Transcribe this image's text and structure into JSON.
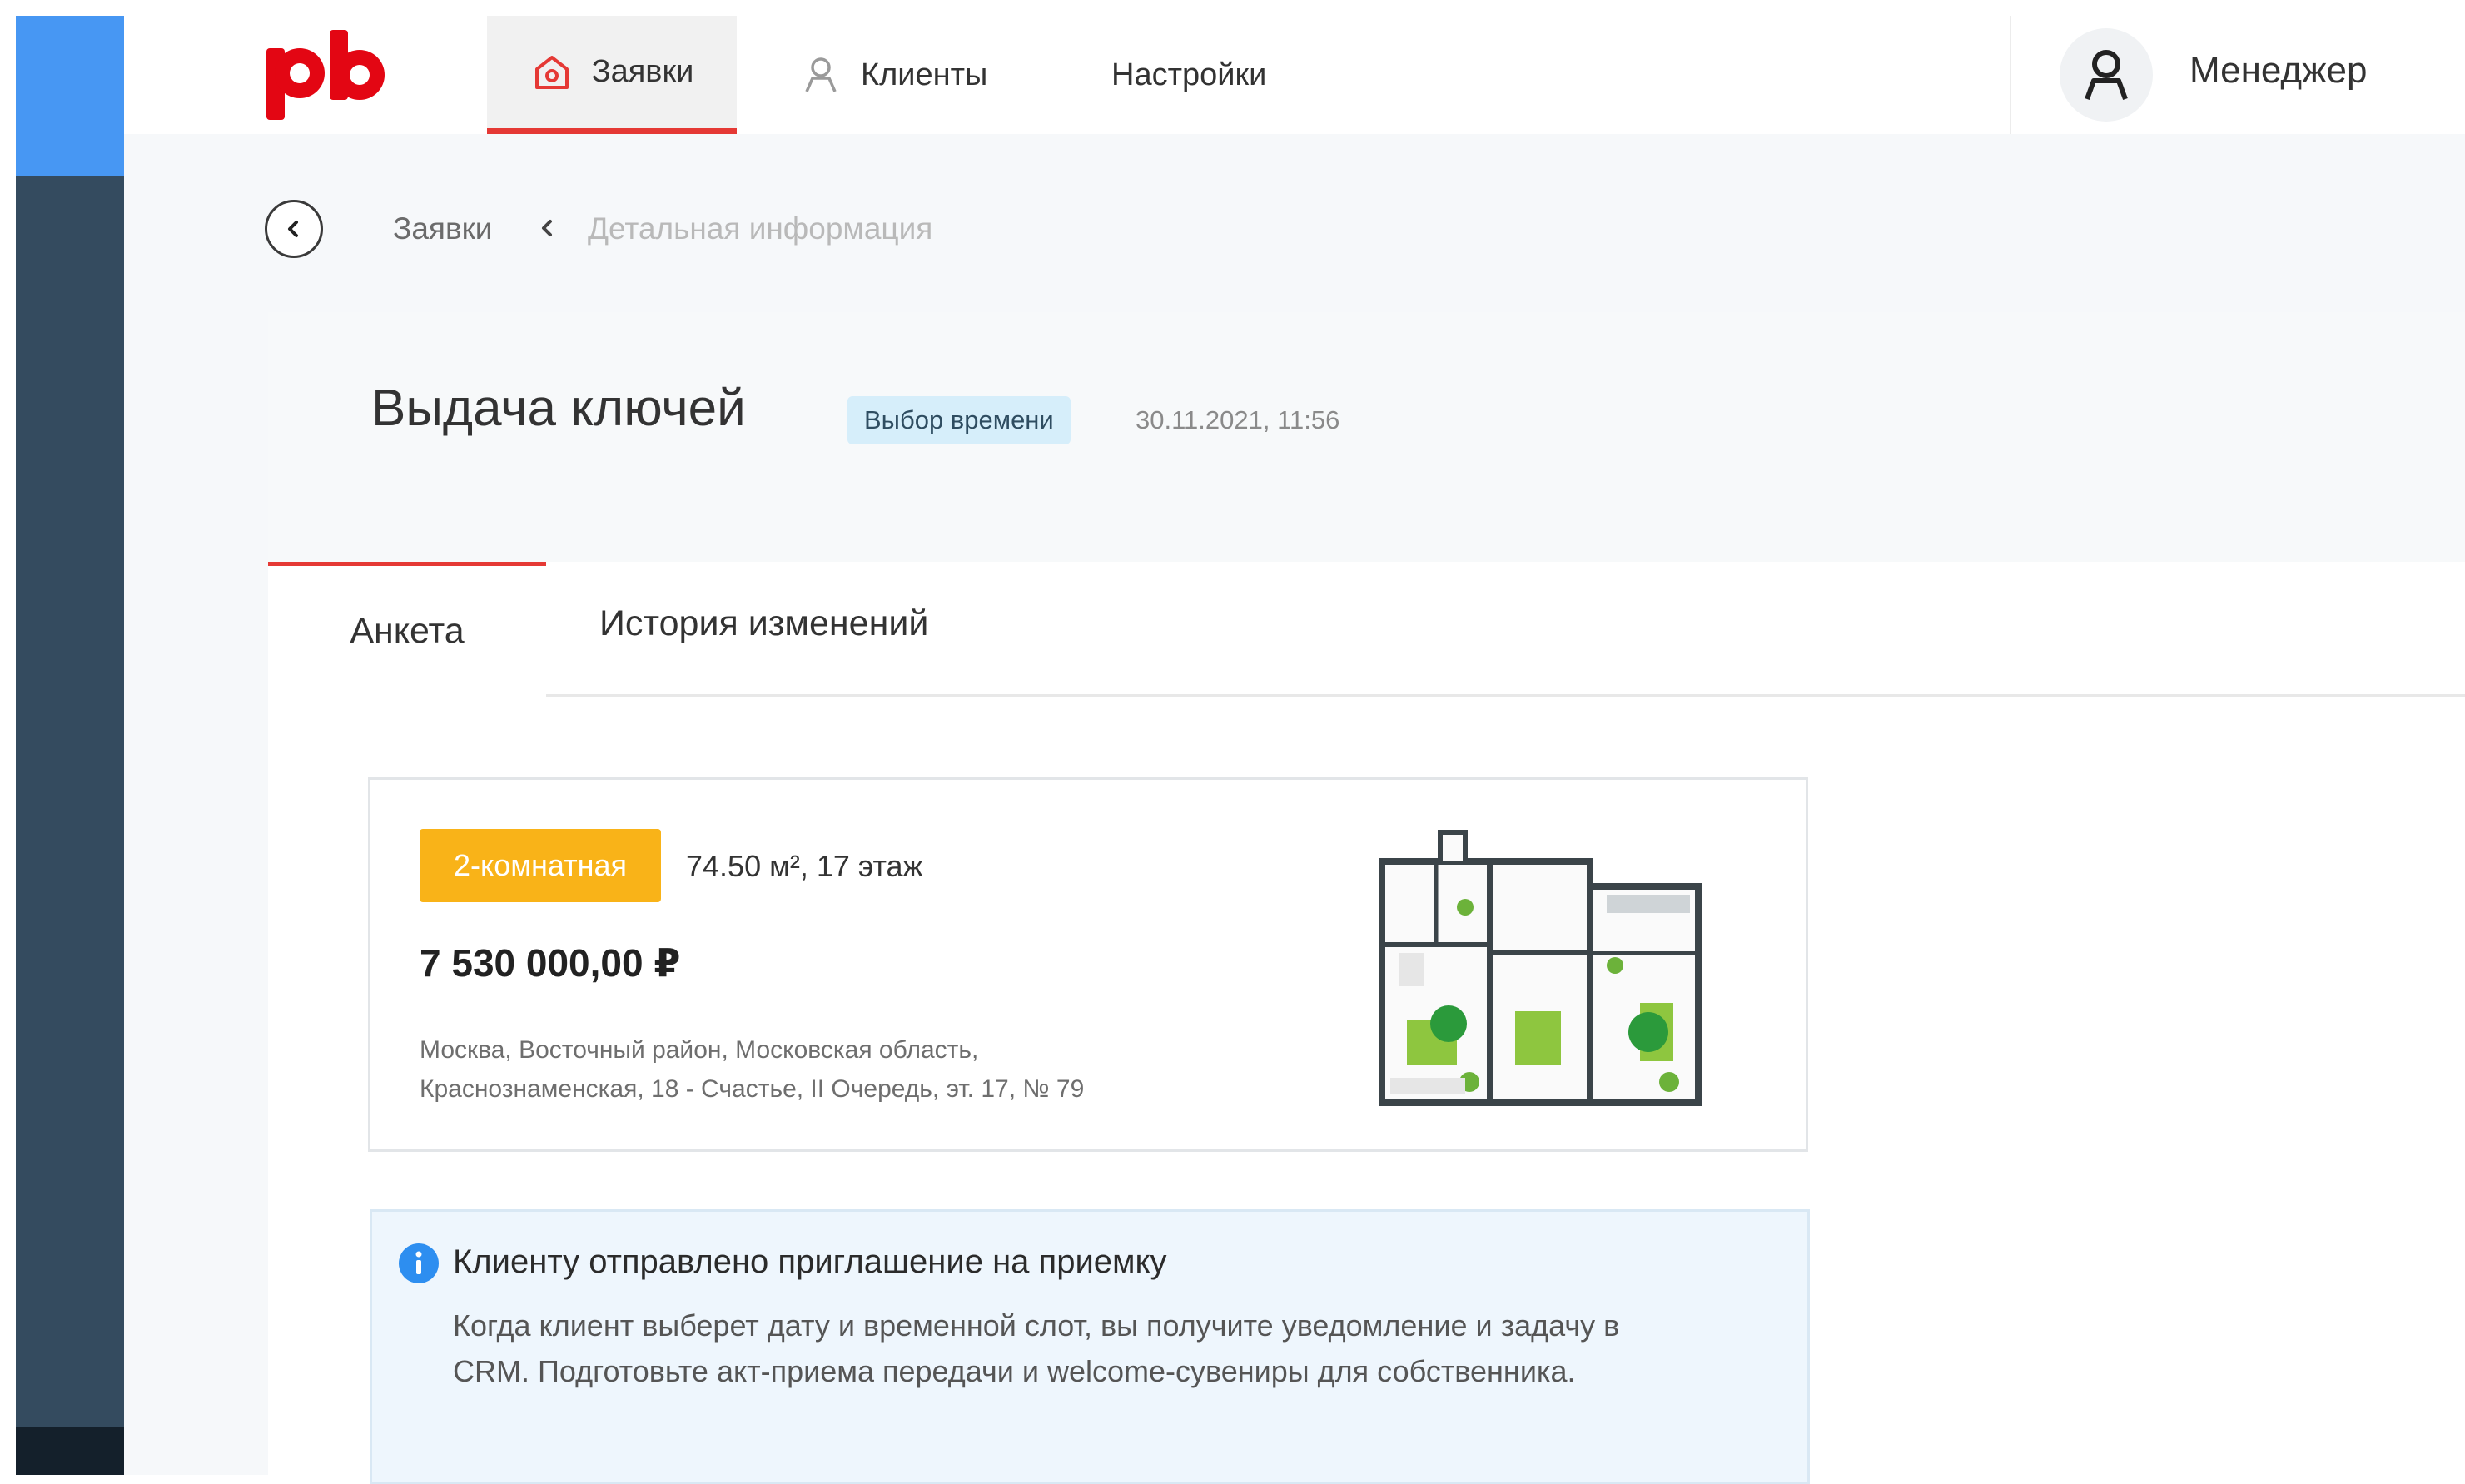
{
  "header": {
    "logo_text": "pb",
    "nav": [
      {
        "label": "Заявки",
        "icon": "home-icon",
        "active": true
      },
      {
        "label": "Клиенты",
        "icon": "user-icon",
        "active": false
      },
      {
        "label": "Настройки",
        "icon": "",
        "active": false
      }
    ],
    "user": {
      "label": "Менеджер",
      "icon": "user-avatar-icon"
    }
  },
  "breadcrumb": {
    "back_icon": "chevron-left-circle-icon",
    "items": [
      "Заявки",
      "Детальная информация"
    ]
  },
  "request": {
    "title": "Выдача ключей",
    "status": "Выбор времени",
    "datetime": "30.11.2021, 11:56"
  },
  "tabs": [
    {
      "label": "Анкета",
      "active": true
    },
    {
      "label": "История изменений",
      "active": false
    }
  ],
  "apartment": {
    "rooms": "2-комнатная",
    "area_floor": "74.50 м², 17 этаж",
    "price": "7 530 000,00 ₽",
    "address_line1": "Москва, Восточный район, Московская область,",
    "address_line2": "Краснознаменская, 18 - Счастье, II Очередь, эт. 17, № 79",
    "plan_icon": "floor-plan-image"
  },
  "info": {
    "icon": "info-icon",
    "title": "Клиенту отправлено приглашение на приемку",
    "body": "Когда клиент выберет дату и временной слот, вы получите уведомление и задачу в CRM. Подготовьте акт-приема передачи и welcome-сувениры для собственника."
  },
  "colors": {
    "accent": "#e53935",
    "sidebar": "#344b5f",
    "sidebar_top": "#4797f3",
    "status_badge": "#d6eefa",
    "rooms_badge": "#f9b318",
    "info_bg": "#eef6fd",
    "info_icon": "#2d8ef0"
  }
}
